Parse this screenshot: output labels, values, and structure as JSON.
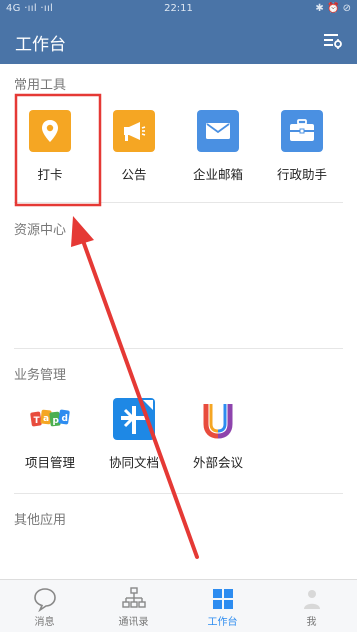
{
  "status_bar": {
    "left": "4G  ·ııl  ·ııl",
    "time": "22:11",
    "right": "✱ ⏰ ⊘"
  },
  "header": {
    "title": "工作台",
    "menu_icon": "settings-list-icon"
  },
  "sections": {
    "common": {
      "title": "常用工具",
      "items": [
        {
          "label": "打卡",
          "icon": "location-pin-icon",
          "color": "#f5a623"
        },
        {
          "label": "公告",
          "icon": "megaphone-icon",
          "color": "#f5a623"
        },
        {
          "label": "企业邮箱",
          "icon": "mail-icon",
          "color": "#4a90e2"
        },
        {
          "label": "行政助手",
          "icon": "briefcase-icon",
          "color": "#4a90e2"
        }
      ]
    },
    "resources": {
      "title": "资源中心"
    },
    "business": {
      "title": "业务管理",
      "items": [
        {
          "label": "项目管理",
          "icon": "trello-logo-icon"
        },
        {
          "label": "协同文档",
          "icon": "docs-logo-icon"
        },
        {
          "label": "外部会议",
          "icon": "meeting-logo-icon"
        }
      ]
    },
    "other": {
      "title": "其他应用"
    }
  },
  "tabbar": [
    {
      "label": "消息",
      "icon": "chat-bubble-icon",
      "active": false
    },
    {
      "label": "通讯录",
      "icon": "org-chart-icon",
      "active": false
    },
    {
      "label": "工作台",
      "icon": "grid-icon",
      "active": true
    },
    {
      "label": "我",
      "icon": "person-icon",
      "active": false
    }
  ],
  "colors": {
    "header": "#4a74a7",
    "accent": "#2d8cf0",
    "highlight": "#e53935"
  }
}
